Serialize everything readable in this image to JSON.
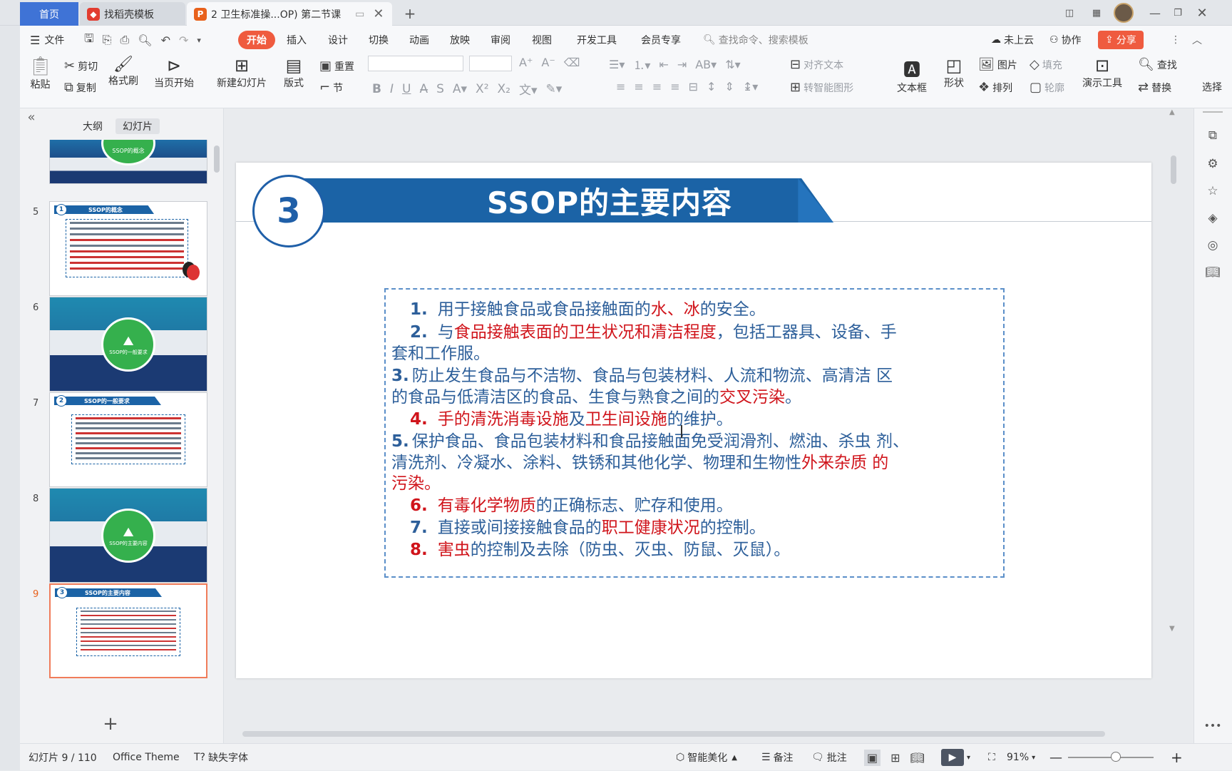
{
  "tabs": {
    "home": "首页",
    "template": "找稻壳模板",
    "doc": "2 卫生标准操...OP) 第二节课"
  },
  "menu": {
    "file": "文件",
    "items": [
      "开始",
      "插入",
      "设计",
      "切换",
      "动画",
      "放映",
      "审阅",
      "视图",
      "开发工具",
      "会员专享"
    ],
    "search_placeholder": "查找命令、搜索模板",
    "cloud": "未上云",
    "collab": "协作",
    "share": "分享"
  },
  "ribbon": {
    "paste": "粘贴",
    "cut": "剪切",
    "copy": "复制",
    "format_painter": "格式刷",
    "from_current": "当页开始",
    "new_slide": "新建幻灯片",
    "layout": "版式",
    "section": "节",
    "reset": "重置",
    "align_text": "对齐文本",
    "to_smartart": "转智能图形",
    "textbox": "文本框",
    "shape": "形状",
    "picture": "图片",
    "fill": "填充",
    "arrange": "排列",
    "outline": "轮廓",
    "present_tools": "演示工具",
    "find": "查找",
    "replace": "替换",
    "select": "选择"
  },
  "panel": {
    "outline_tab": "大纲",
    "slides_tab": "幻灯片",
    "thumbs": [
      {
        "num": "5",
        "title": "SSOP的概念",
        "badge": "1"
      },
      {
        "num": "6",
        "title": "SSOP的一般要求"
      },
      {
        "num": "7",
        "title": "SSOP的一般要求",
        "badge": "2"
      },
      {
        "num": "8",
        "title": "SSOP的主要内容"
      },
      {
        "num": "9",
        "title": "SSOP的主要内容",
        "badge": "3"
      }
    ],
    "top_thumb_title": "SSOP的概念"
  },
  "slide": {
    "number": "3",
    "title": "SSOP的主要内容",
    "items": [
      {
        "num": "1.",
        "parts": [
          [
            "用于接触食品或食品接触面的",
            "b"
          ],
          [
            "水、冰",
            "r"
          ],
          [
            "的安全。",
            "b"
          ]
        ]
      },
      {
        "num": "2.",
        "parts": [
          [
            "与",
            "b"
          ],
          [
            "食品接触表面的卫生状况和清洁程度",
            "r"
          ],
          [
            "，包括工器具、设备、手",
            "b"
          ]
        ]
      },
      {
        "num": "",
        "parts": [
          [
            "套和工作服。",
            "b"
          ]
        ]
      },
      {
        "num": "3.",
        "parts": [
          [
            "防止发生食品与不洁物、食品与包装材料、人流和物流、高清洁 区",
            "b"
          ]
        ]
      },
      {
        "num": "",
        "parts": [
          [
            "的食品与低清洁区的食品、生食与熟食之间的",
            "b"
          ],
          [
            "交叉污染",
            "r"
          ],
          [
            "。",
            "b"
          ]
        ]
      },
      {
        "num": "4.",
        "parts": [
          [
            "手的",
            "r"
          ],
          [
            "清洗消毒设施",
            "r"
          ],
          [
            "及",
            "b"
          ],
          [
            "卫生间设施",
            "r"
          ],
          [
            "的维护。",
            "b"
          ]
        ]
      },
      {
        "num": "5.",
        "parts": [
          [
            "保护食品、食品包装材料和食品接触面免受润滑剂、燃油、杀虫 剂、",
            "b"
          ]
        ]
      },
      {
        "num": "",
        "parts": [
          [
            "清洗剂、冷凝水、涂料、铁锈和其他化学、物理和生物性",
            "b"
          ],
          [
            "外来杂质 的",
            "r"
          ]
        ]
      },
      {
        "num": "",
        "parts": [
          [
            "污染。",
            "r"
          ]
        ]
      },
      {
        "num": "6.",
        "parts": [
          [
            "有毒化学物质",
            "r"
          ],
          [
            "的正确标志、贮存和使用。",
            "b"
          ]
        ]
      },
      {
        "num": "7.",
        "parts": [
          [
            "直接或间接接触食品的",
            "b"
          ],
          [
            "职工健康状况",
            "r"
          ],
          [
            "的控制。",
            "b"
          ]
        ]
      },
      {
        "num": "8.",
        "parts": [
          [
            "害虫",
            "r"
          ],
          [
            "的控制及去除（防虫、灭虫、防鼠、灭鼠）。",
            "b"
          ]
        ]
      }
    ]
  },
  "status": {
    "slide_info": "幻灯片 9 / 110",
    "theme": "Office Theme",
    "missing_font": "缺失字体",
    "beautify": "智能美化",
    "notes": "备注",
    "comment": "批注",
    "zoom": "91%"
  },
  "colors": {
    "accent_blue": "#1f5fa8",
    "title_bar": "#1b63a6",
    "red_text": "#d0141b",
    "blue_text": "#2d5f9a",
    "share_btn": "#ef5b3f"
  }
}
